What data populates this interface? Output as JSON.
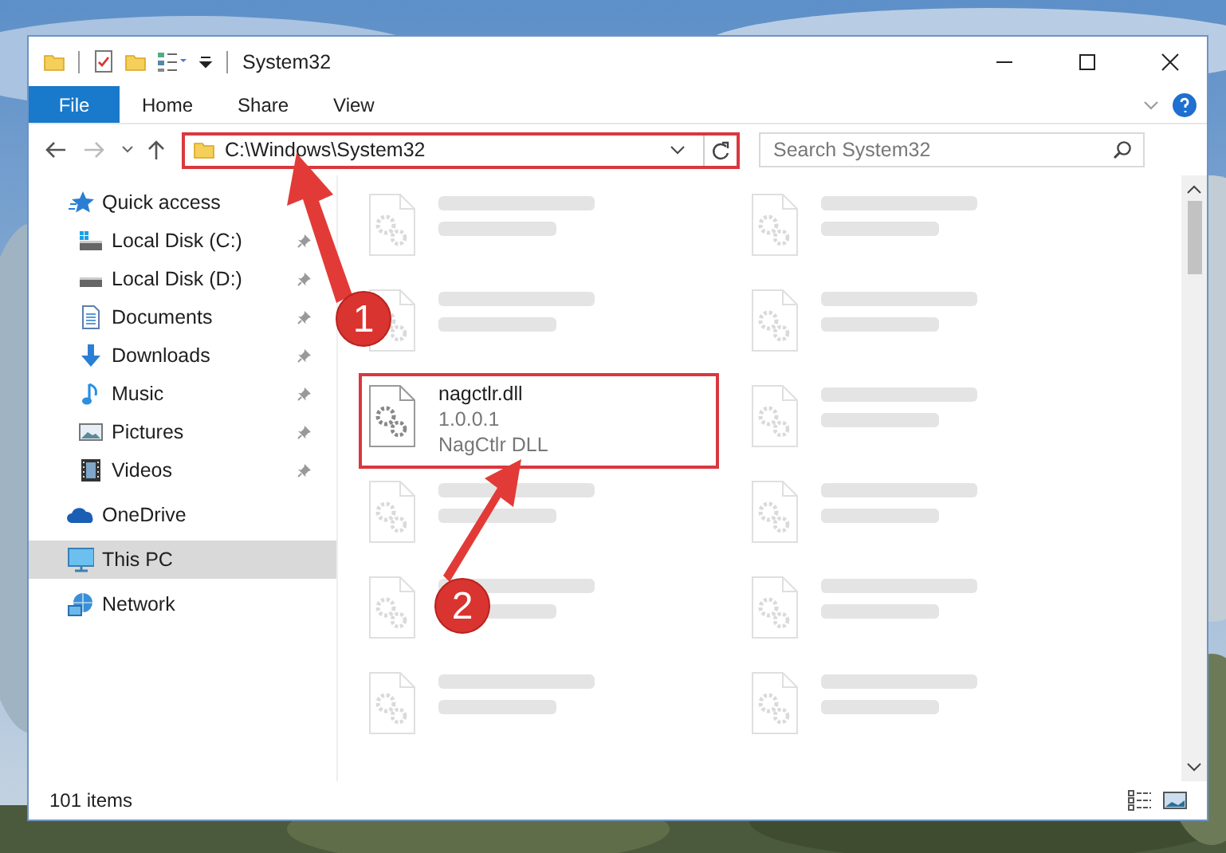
{
  "window": {
    "title": "System32"
  },
  "ribbon_tabs": [
    {
      "label": "File",
      "kind": "file"
    },
    {
      "label": "Home",
      "kind": "tab"
    },
    {
      "label": "Share",
      "kind": "tab"
    },
    {
      "label": "View",
      "kind": "tab"
    }
  ],
  "address_bar": {
    "path": "C:\\Windows\\System32",
    "highlighted": true
  },
  "search": {
    "placeholder": "Search System32"
  },
  "nav_pane": [
    {
      "label": "Quick access",
      "kind": "star",
      "selected": false,
      "children": [
        {
          "label": "Local Disk (C:)",
          "kind": "systemdrive",
          "pinned": true,
          "selected": false
        },
        {
          "label": "Local Disk (D:)",
          "kind": "drive",
          "pinned": true,
          "selected": false
        },
        {
          "label": "Documents",
          "kind": "document",
          "pinned": true,
          "selected": false
        },
        {
          "label": "Downloads",
          "kind": "download",
          "pinned": true,
          "selected": false
        },
        {
          "label": "Music",
          "kind": "music",
          "pinned": true,
          "selected": false
        },
        {
          "label": "Pictures",
          "kind": "pictures",
          "pinned": true,
          "selected": false
        },
        {
          "label": "Videos",
          "kind": "videos",
          "pinned": true,
          "selected": false
        }
      ]
    },
    {
      "label": "OneDrive",
      "kind": "cloud",
      "selected": false
    },
    {
      "label": "This PC",
      "kind": "monitor",
      "selected": true
    },
    {
      "label": "Network",
      "kind": "network",
      "selected": false
    }
  ],
  "files": [
    {
      "kind": "blurred",
      "highlighted": false
    },
    {
      "kind": "blurred",
      "highlighted": false
    },
    {
      "kind": "blurred",
      "highlighted": false
    },
    {
      "kind": "blurred",
      "highlighted": false
    },
    {
      "kind": "file",
      "name": "nagctlr.dll",
      "lines": [
        "1.0.0.1",
        "NagCtlr DLL"
      ],
      "highlighted": true
    },
    {
      "kind": "blurred",
      "highlighted": false
    },
    {
      "kind": "blurred",
      "highlighted": false
    },
    {
      "kind": "blurred",
      "highlighted": false
    },
    {
      "kind": "blurred",
      "highlighted": false
    },
    {
      "kind": "blurred",
      "highlighted": false
    },
    {
      "kind": "blurred",
      "highlighted": false
    },
    {
      "kind": "blurred",
      "highlighted": false
    }
  ],
  "status_bar": {
    "text": "101 items"
  },
  "callouts": [
    {
      "number": "1"
    },
    {
      "number": "2"
    }
  ]
}
